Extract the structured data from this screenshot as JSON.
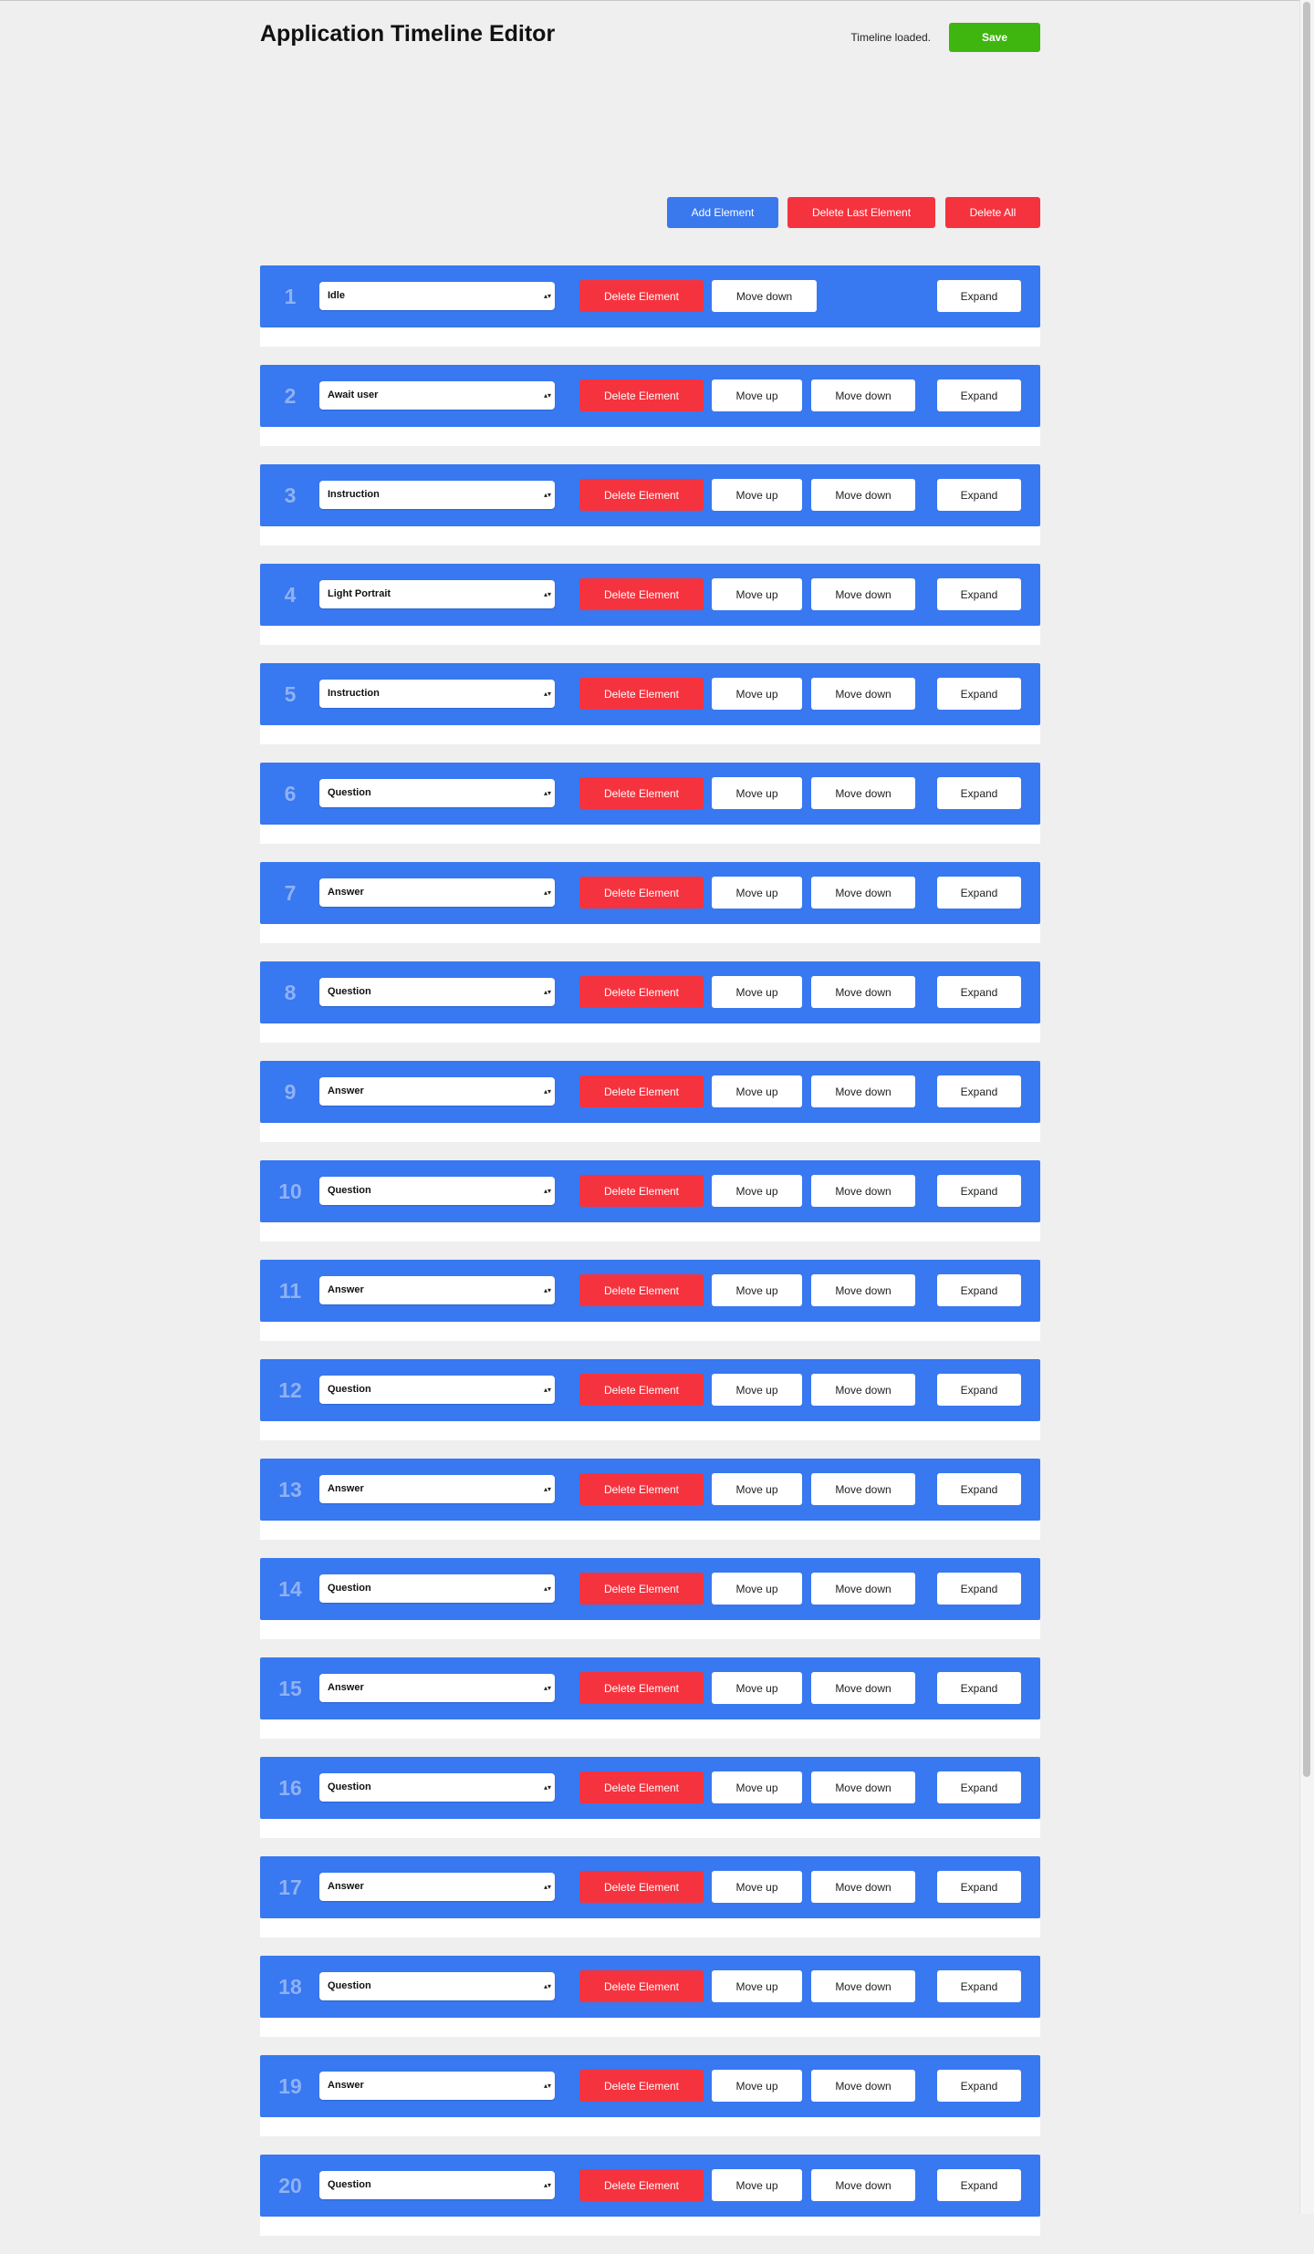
{
  "header": {
    "title": "Application Timeline Editor",
    "status": "Timeline loaded.",
    "save_label": "Save"
  },
  "toolbar": {
    "add_label": "Add Element",
    "delete_last_label": "Delete Last Element",
    "delete_all_label": "Delete All"
  },
  "element_buttons": {
    "delete_label": "Delete Element",
    "move_up_label": "Move up",
    "move_down_label": "Move down",
    "expand_label": "Expand",
    "select_arrows": "▴▾"
  },
  "elements": [
    {
      "index": "1",
      "type": "Idle"
    },
    {
      "index": "2",
      "type": "Await user"
    },
    {
      "index": "3",
      "type": "Instruction"
    },
    {
      "index": "4",
      "type": "Light Portrait"
    },
    {
      "index": "5",
      "type": "Instruction"
    },
    {
      "index": "6",
      "type": "Question"
    },
    {
      "index": "7",
      "type": "Answer"
    },
    {
      "index": "8",
      "type": "Question"
    },
    {
      "index": "9",
      "type": "Answer"
    },
    {
      "index": "10",
      "type": "Question"
    },
    {
      "index": "11",
      "type": "Answer"
    },
    {
      "index": "12",
      "type": "Question"
    },
    {
      "index": "13",
      "type": "Answer"
    },
    {
      "index": "14",
      "type": "Question"
    },
    {
      "index": "15",
      "type": "Answer"
    },
    {
      "index": "16",
      "type": "Question"
    },
    {
      "index": "17",
      "type": "Answer"
    },
    {
      "index": "18",
      "type": "Question"
    },
    {
      "index": "19",
      "type": "Answer"
    },
    {
      "index": "20",
      "type": "Question"
    }
  ],
  "colors": {
    "background": "#efefef",
    "element_header": "#3878f0",
    "primary_button": "#3a78ee",
    "danger_button": "#f5333f",
    "save_button": "#3fb50f",
    "index_number": "#8fb1f5"
  }
}
